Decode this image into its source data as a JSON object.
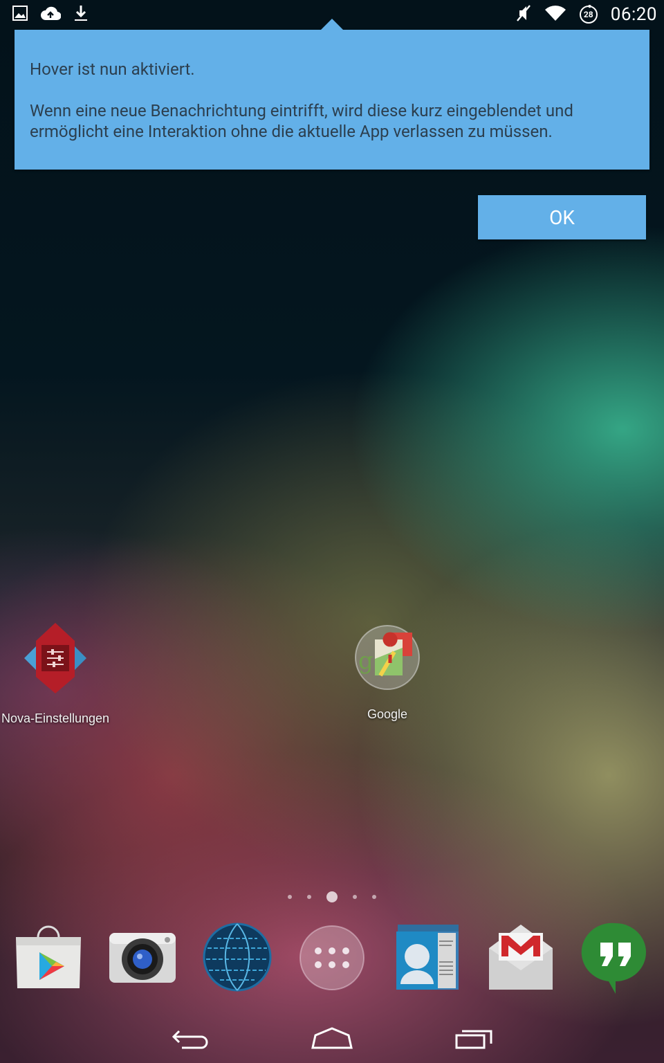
{
  "status_bar": {
    "left_icons": [
      "image-icon",
      "cloud-upload-icon",
      "download-icon"
    ],
    "right_icons": [
      "mute-icon",
      "wifi-icon",
      "battery-icon"
    ],
    "battery_level": "28",
    "time": "06:20"
  },
  "tooltip": {
    "title": "Hover ist nun aktiviert.",
    "body": "Wenn eine neue Benachrichtung eintrifft, wird diese kurz eingeblendet und ermöglicht eine Interaktion ohne die aktuelle App verlassen zu müssen.",
    "ok_label": "OK",
    "color": "#63b0e8"
  },
  "home_apps": [
    {
      "label": "Nova-Einstellungen",
      "icon": "nova-settings-icon"
    },
    {
      "label": "Google",
      "icon": "google-folder-icon"
    }
  ],
  "page_indicator": {
    "pages": 5,
    "current": 3
  },
  "dock": [
    {
      "icon": "play-store-icon"
    },
    {
      "icon": "camera-icon"
    },
    {
      "icon": "browser-globe-icon"
    },
    {
      "icon": "app-drawer-icon"
    },
    {
      "icon": "contacts-icon"
    },
    {
      "icon": "gmail-icon"
    },
    {
      "icon": "hangouts-icon"
    }
  ],
  "nav_bar": [
    "back-icon",
    "home-icon",
    "recent-apps-icon"
  ]
}
